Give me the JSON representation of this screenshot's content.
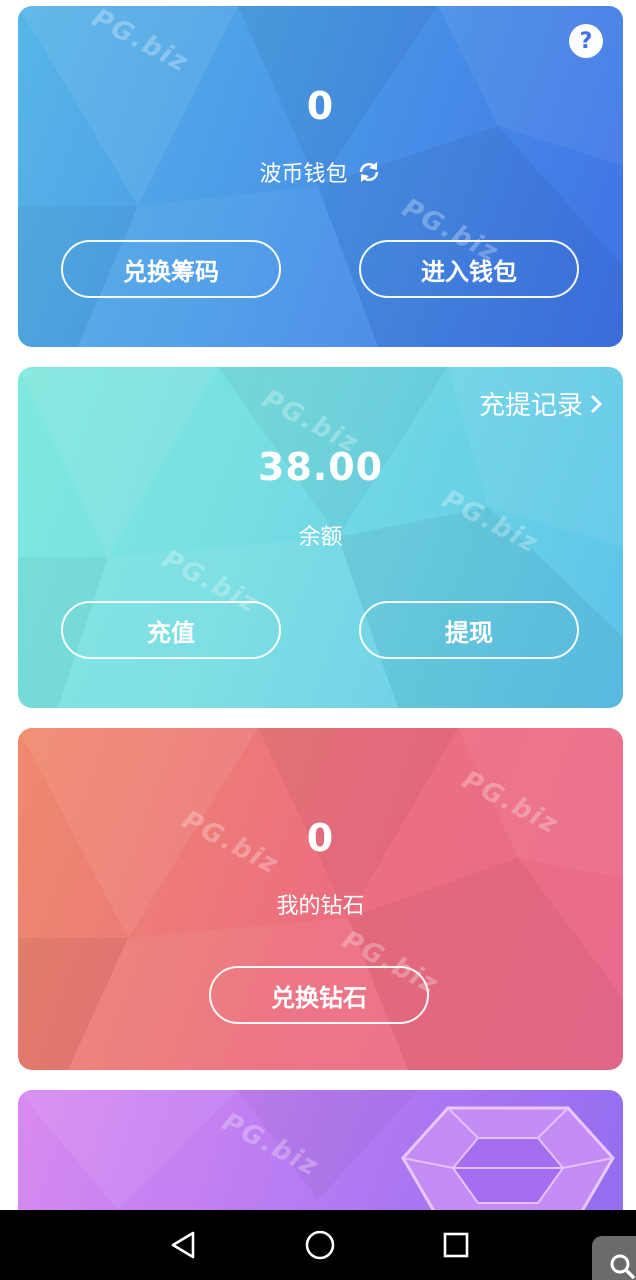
{
  "wallet_card": {
    "value": "0",
    "label": "波币钱包",
    "left_button": "兑换筹码",
    "right_button": "进入钱包",
    "help_glyph": "?",
    "refresh_icon": "refresh-icon",
    "color": "#4a98e8"
  },
  "balance_card": {
    "record_link": "充提记录",
    "value": "38.00",
    "label": "余额",
    "left_button": "充值",
    "right_button": "提现",
    "color": "#76dde3"
  },
  "diamond_card": {
    "value": "0",
    "label": "我的钻石",
    "button": "兑换钻石",
    "color": "#ec6f7f"
  },
  "partial_card": {
    "icon": "gem-icon",
    "color": "#b57af2"
  },
  "watermark_text": "PG.biz",
  "navbar": {
    "back_icon": "back-triangle-icon",
    "home_icon": "home-circle-icon",
    "recents_icon": "recents-square-icon",
    "floating_search_icon": "search-icon"
  }
}
